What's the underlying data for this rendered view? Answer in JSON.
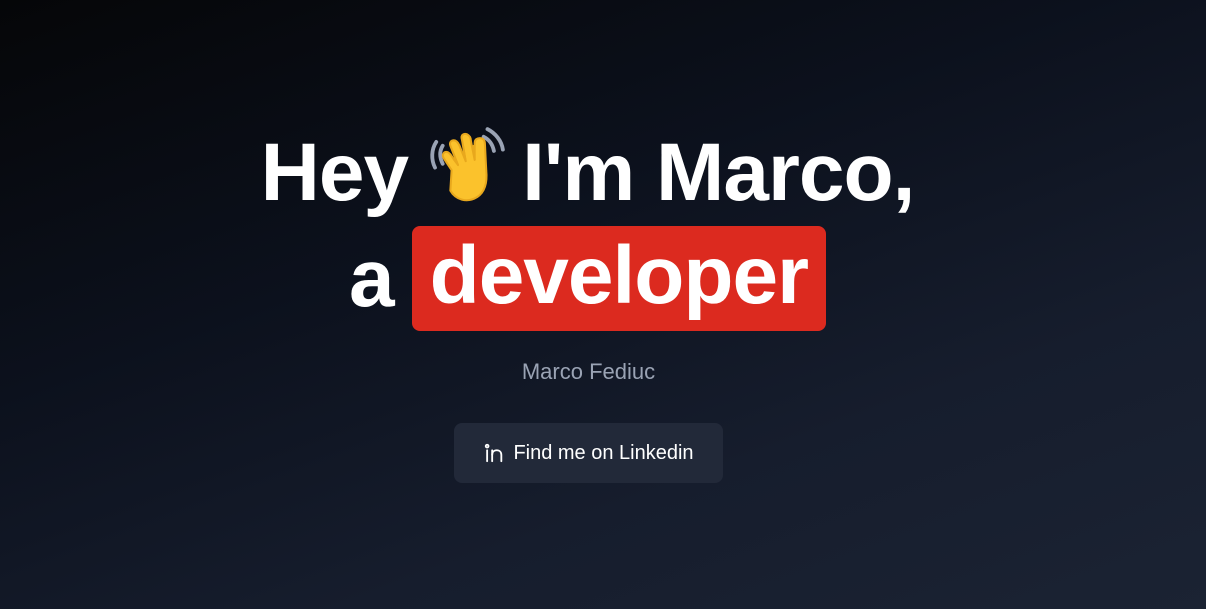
{
  "hero": {
    "line1_before_icon": "Hey",
    "wave_icon": "waving-hand-icon",
    "line1_after_icon": "I'm Marco,",
    "line2_article": "a",
    "highlight_word": "developer",
    "subtitle": "Marco Fediuc",
    "cta": {
      "label": "Find me on Linkedin",
      "icon": "linkedin-icon"
    }
  },
  "colors": {
    "highlight_bg": "#dc2a1f",
    "text": "#ffffff",
    "subtitle": "#9aa3b4",
    "button_bg": "#222939"
  }
}
